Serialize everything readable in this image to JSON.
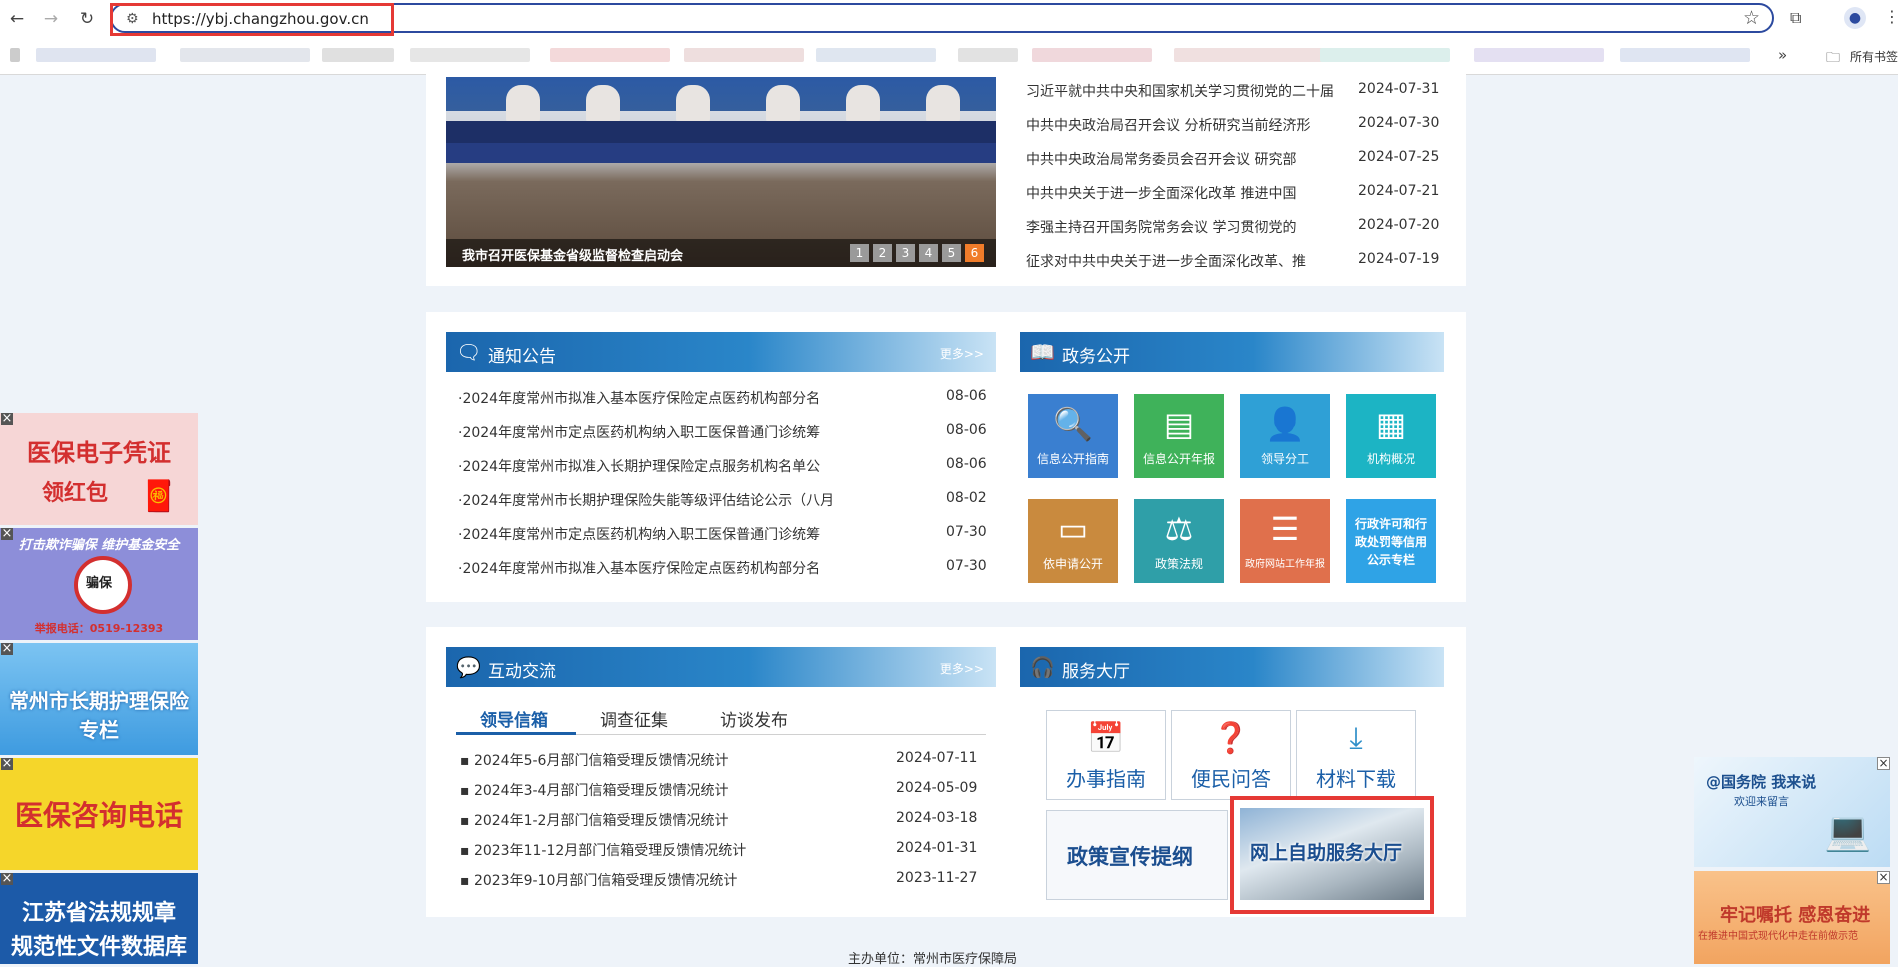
{
  "browser": {
    "url": "https://ybj.changzhou.gov.cn",
    "back_glyph": "←",
    "forward_glyph": "→",
    "reload_glyph": "↻",
    "more_bookmarks_glyph": "»",
    "all_bookmarks_label": "所有书签",
    "highlight_color": "#e53935"
  },
  "carousel": {
    "caption": "我市召开医保基金省级监督检查启动会",
    "slides": [
      "1",
      "2",
      "3",
      "4",
      "5",
      "6"
    ],
    "active_slide": "6"
  },
  "top_news": [
    {
      "title": "习近平就中共中央和国家机关学习贯彻党的二十届",
      "date": "2024-07-31"
    },
    {
      "title": "中共中央政治局召开会议 分析研究当前经济形",
      "date": "2024-07-30"
    },
    {
      "title": "中共中央政治局常务委员会召开会议 研究部",
      "date": "2024-07-25"
    },
    {
      "title": "中共中央关于进一步全面深化改革 推进中国",
      "date": "2024-07-21"
    },
    {
      "title": "李强主持召开国务院常务会议 学习贯彻党的",
      "date": "2024-07-20"
    },
    {
      "title": "征求对中共中央关于进一步全面深化改革、推",
      "date": "2024-07-19"
    }
  ],
  "notices": {
    "title": "通知公告",
    "more": "更多>>",
    "items": [
      {
        "title": "·2024年度常州市拟准入基本医疗保险定点医药机构部分名",
        "date": "08-06"
      },
      {
        "title": "·2024年度常州市定点医药机构纳入职工医保普通门诊统筹",
        "date": "08-06"
      },
      {
        "title": "·2024年度常州市拟准入长期护理保险定点服务机构名单公",
        "date": "08-06"
      },
      {
        "title": "·2024年度常州市长期护理保险失能等级评估结论公示（八月",
        "date": "08-02"
      },
      {
        "title": "·2024年度常州市定点医药机构纳入职工医保普通门诊统筹",
        "date": "07-30"
      },
      {
        "title": "·2024年度常州市拟准入基本医疗保险定点医药机构部分名",
        "date": "07-30"
      }
    ]
  },
  "gov_affairs": {
    "title": "政务公开",
    "tiles": [
      {
        "label": "信息公开指南",
        "icon": "search-doc-icon",
        "glyph": "🔍",
        "color": "#3a7fd0"
      },
      {
        "label": "信息公开年报",
        "icon": "report-icon",
        "glyph": "▤",
        "color": "#3fb25a"
      },
      {
        "label": "领导分工",
        "icon": "leader-icon",
        "glyph": "👤",
        "color": "#2fa0d6"
      },
      {
        "label": "机构概况",
        "icon": "building-icon",
        "glyph": "▦",
        "color": "#1cb4c4"
      },
      {
        "label": "依申请公开",
        "icon": "inbox-icon",
        "glyph": "▭",
        "color": "#c98a3e"
      },
      {
        "label": "政策法规",
        "icon": "scales-icon",
        "glyph": "⚖",
        "color": "#2f9fa8"
      },
      {
        "label": "政府网站工作年报",
        "icon": "list-icon",
        "glyph": "☰",
        "color": "#e0704c"
      },
      {
        "label": "行政许可和行政处罚等信用公示专栏",
        "icon": "credit-icon",
        "glyph": "",
        "color": "#2fa3e6"
      }
    ]
  },
  "interaction": {
    "title": "互动交流",
    "more": "更多>>",
    "tabs": [
      "领导信箱",
      "调查征集",
      "访谈发布"
    ],
    "items": [
      {
        "title": "2024年5-6月部门信箱受理反馈情况统计",
        "date": "2024-07-11"
      },
      {
        "title": "2024年3-4月部门信箱受理反馈情况统计",
        "date": "2024-05-09"
      },
      {
        "title": "2024年1-2月部门信箱受理反馈情况统计",
        "date": "2024-03-18"
      },
      {
        "title": "2023年11-12月部门信箱受理反馈情况统计",
        "date": "2024-01-31"
      },
      {
        "title": "2023年9-10月部门信箱受理反馈情况统计",
        "date": "2023-11-27"
      }
    ]
  },
  "service_hall": {
    "title": "服务大厅",
    "items": [
      {
        "label": "办事指南",
        "icon": "guide-icon",
        "glyph": "📅",
        "color": "#2f9f4f"
      },
      {
        "label": "便民问答",
        "icon": "qa-icon",
        "glyph": "❓",
        "color": "#c48b3a"
      },
      {
        "label": "材料下载",
        "icon": "download-icon",
        "glyph": "⤓",
        "color": "#2f8fc9"
      }
    ],
    "policy": "政策宣传提纲",
    "self_service": "网上自助服务大厅"
  },
  "left_ads": [
    {
      "lines": [
        "医保电子凭证",
        "领红包"
      ],
      "bg": "#f7d9d9",
      "color": "#d32f2f"
    },
    {
      "lines": [
        "打击欺诈骗保 维护基金安全",
        "骗保",
        "举报电话：0519-12393"
      ],
      "bg": "#8f8fd8",
      "color": "#ffffff"
    },
    {
      "lines": [
        "常州市长期护理保险专栏"
      ],
      "bg": "#4aa6e8",
      "color": "#ffffff"
    },
    {
      "lines": [
        "医保咨询电话"
      ],
      "bg": "#f6d62a",
      "color": "#d32f2f"
    },
    {
      "lines": [
        "江苏省法规规章",
        "规范性文件数据库"
      ],
      "bg": "#1c5aa8",
      "color": "#ffffff"
    }
  ],
  "right_ads": [
    {
      "lines": [
        "@国务院 我来说",
        "欢迎来留言"
      ],
      "bg": "#dcecf8",
      "color": "#1c4f8e"
    },
    {
      "lines": [
        "牢记嘱托 感恩奋进",
        "在推进中国式现代化中走在前做示范"
      ],
      "bg": "#f5b47a",
      "color": "#c0392b"
    }
  ],
  "footer": {
    "text": "主办单位：常州市医疗保障局"
  }
}
